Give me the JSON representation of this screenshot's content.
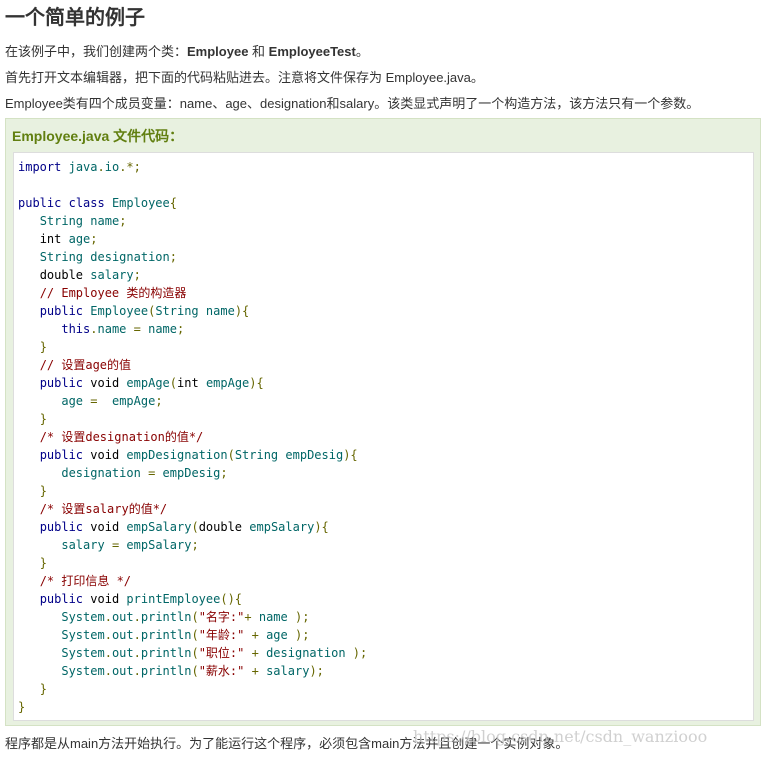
{
  "heading": "一个简单的例子",
  "paragraphs": {
    "p1_prefix": "在该例子中，我们创建两个类：",
    "p1_class1": "Employee",
    "p1_mid": " 和 ",
    "p1_class2": "EmployeeTest",
    "p1_suffix": "。",
    "p2": "首先打开文本编辑器，把下面的代码粘贴进去。注意将文件保存为 Employee.java。",
    "p3": "Employee类有四个成员变量：name、age、designation和salary。该类显式声明了一个构造方法，该方法只有一个参数。",
    "bottom": "程序都是从main方法开始执行。为了能运行这个程序，必须包含main方法并且创建一个实例对象。"
  },
  "example": {
    "title": "Employee.java 文件代码："
  },
  "code_lines": [
    [
      [
        "kw2",
        "import"
      ],
      [
        "plain",
        " "
      ],
      [
        "var",
        "java"
      ],
      [
        "pun",
        "."
      ],
      [
        "var",
        "io"
      ],
      [
        "pun",
        ".*;"
      ]
    ],
    [],
    [
      [
        "kw2",
        "public"
      ],
      [
        "plain",
        " "
      ],
      [
        "kw2",
        "class"
      ],
      [
        "plain",
        " "
      ],
      [
        "var",
        "Employee"
      ],
      [
        "pun",
        "{"
      ]
    ],
    [
      [
        "plain",
        "   "
      ],
      [
        "var",
        "String"
      ],
      [
        "plain",
        " "
      ],
      [
        "var",
        "name"
      ],
      [
        "pun",
        ";"
      ]
    ],
    [
      [
        "plain",
        "   "
      ],
      [
        "plain",
        "int"
      ],
      [
        "plain",
        " "
      ],
      [
        "var",
        "age"
      ],
      [
        "pun",
        ";"
      ]
    ],
    [
      [
        "plain",
        "   "
      ],
      [
        "var",
        "String"
      ],
      [
        "plain",
        " "
      ],
      [
        "var",
        "designation"
      ],
      [
        "pun",
        ";"
      ]
    ],
    [
      [
        "plain",
        "   "
      ],
      [
        "plain",
        "double"
      ],
      [
        "plain",
        " "
      ],
      [
        "var",
        "salary"
      ],
      [
        "pun",
        ";"
      ]
    ],
    [
      [
        "plain",
        "   "
      ],
      [
        "cm",
        "// Employee 类的构造器"
      ]
    ],
    [
      [
        "plain",
        "   "
      ],
      [
        "kw2",
        "public"
      ],
      [
        "plain",
        " "
      ],
      [
        "var",
        "Employee"
      ],
      [
        "pun",
        "("
      ],
      [
        "var",
        "String"
      ],
      [
        "plain",
        " "
      ],
      [
        "var",
        "name"
      ],
      [
        "pun",
        "){"
      ]
    ],
    [
      [
        "plain",
        "      "
      ],
      [
        "kw",
        "this"
      ],
      [
        "pun",
        "."
      ],
      [
        "var",
        "name"
      ],
      [
        "plain",
        " "
      ],
      [
        "pun",
        "="
      ],
      [
        "plain",
        " "
      ],
      [
        "var",
        "name"
      ],
      [
        "pun",
        ";"
      ]
    ],
    [
      [
        "plain",
        "   "
      ],
      [
        "pun",
        "}"
      ]
    ],
    [
      [
        "plain",
        "   "
      ],
      [
        "cm",
        "// 设置age的值"
      ]
    ],
    [
      [
        "plain",
        "   "
      ],
      [
        "kw2",
        "public"
      ],
      [
        "plain",
        " "
      ],
      [
        "plain",
        "void"
      ],
      [
        "plain",
        " "
      ],
      [
        "var",
        "empAge"
      ],
      [
        "pun",
        "("
      ],
      [
        "plain",
        "int"
      ],
      [
        "plain",
        " "
      ],
      [
        "var",
        "empAge"
      ],
      [
        "pun",
        "){"
      ]
    ],
    [
      [
        "plain",
        "      "
      ],
      [
        "var",
        "age"
      ],
      [
        "plain",
        " "
      ],
      [
        "pun",
        "="
      ],
      [
        "plain",
        "  "
      ],
      [
        "var",
        "empAge"
      ],
      [
        "pun",
        ";"
      ]
    ],
    [
      [
        "plain",
        "   "
      ],
      [
        "pun",
        "}"
      ]
    ],
    [
      [
        "plain",
        "   "
      ],
      [
        "cm",
        "/* 设置designation的值*/"
      ]
    ],
    [
      [
        "plain",
        "   "
      ],
      [
        "kw2",
        "public"
      ],
      [
        "plain",
        " "
      ],
      [
        "plain",
        "void"
      ],
      [
        "plain",
        " "
      ],
      [
        "var",
        "empDesignation"
      ],
      [
        "pun",
        "("
      ],
      [
        "var",
        "String"
      ],
      [
        "plain",
        " "
      ],
      [
        "var",
        "empDesig"
      ],
      [
        "pun",
        "){"
      ]
    ],
    [
      [
        "plain",
        "      "
      ],
      [
        "var",
        "designation"
      ],
      [
        "plain",
        " "
      ],
      [
        "pun",
        "="
      ],
      [
        "plain",
        " "
      ],
      [
        "var",
        "empDesig"
      ],
      [
        "pun",
        ";"
      ]
    ],
    [
      [
        "plain",
        "   "
      ],
      [
        "pun",
        "}"
      ]
    ],
    [
      [
        "plain",
        "   "
      ],
      [
        "cm",
        "/* 设置salary的值*/"
      ]
    ],
    [
      [
        "plain",
        "   "
      ],
      [
        "kw2",
        "public"
      ],
      [
        "plain",
        " "
      ],
      [
        "plain",
        "void"
      ],
      [
        "plain",
        " "
      ],
      [
        "var",
        "empSalary"
      ],
      [
        "pun",
        "("
      ],
      [
        "plain",
        "double"
      ],
      [
        "plain",
        " "
      ],
      [
        "var",
        "empSalary"
      ],
      [
        "pun",
        "){"
      ]
    ],
    [
      [
        "plain",
        "      "
      ],
      [
        "var",
        "salary"
      ],
      [
        "plain",
        " "
      ],
      [
        "pun",
        "="
      ],
      [
        "plain",
        " "
      ],
      [
        "var",
        "empSalary"
      ],
      [
        "pun",
        ";"
      ]
    ],
    [
      [
        "plain",
        "   "
      ],
      [
        "pun",
        "}"
      ]
    ],
    [
      [
        "plain",
        "   "
      ],
      [
        "cm",
        "/* 打印信息 */"
      ]
    ],
    [
      [
        "plain",
        "   "
      ],
      [
        "kw2",
        "public"
      ],
      [
        "plain",
        " "
      ],
      [
        "plain",
        "void"
      ],
      [
        "plain",
        " "
      ],
      [
        "var",
        "printEmployee"
      ],
      [
        "pun",
        "(){"
      ]
    ],
    [
      [
        "plain",
        "      "
      ],
      [
        "var",
        "System"
      ],
      [
        "pun",
        "."
      ],
      [
        "var",
        "out"
      ],
      [
        "pun",
        "."
      ],
      [
        "var",
        "println"
      ],
      [
        "pun",
        "("
      ],
      [
        "str",
        "\"名字:\""
      ],
      [
        "pun",
        "+"
      ],
      [
        "plain",
        " "
      ],
      [
        "var",
        "name"
      ],
      [
        "plain",
        " "
      ],
      [
        "pun",
        ");"
      ]
    ],
    [
      [
        "plain",
        "      "
      ],
      [
        "var",
        "System"
      ],
      [
        "pun",
        "."
      ],
      [
        "var",
        "out"
      ],
      [
        "pun",
        "."
      ],
      [
        "var",
        "println"
      ],
      [
        "pun",
        "("
      ],
      [
        "str",
        "\"年龄:\""
      ],
      [
        "plain",
        " "
      ],
      [
        "pun",
        "+"
      ],
      [
        "plain",
        " "
      ],
      [
        "var",
        "age"
      ],
      [
        "plain",
        " "
      ],
      [
        "pun",
        ");"
      ]
    ],
    [
      [
        "plain",
        "      "
      ],
      [
        "var",
        "System"
      ],
      [
        "pun",
        "."
      ],
      [
        "var",
        "out"
      ],
      [
        "pun",
        "."
      ],
      [
        "var",
        "println"
      ],
      [
        "pun",
        "("
      ],
      [
        "str",
        "\"职位:\""
      ],
      [
        "plain",
        " "
      ],
      [
        "pun",
        "+"
      ],
      [
        "plain",
        " "
      ],
      [
        "var",
        "designation"
      ],
      [
        "plain",
        " "
      ],
      [
        "pun",
        ");"
      ]
    ],
    [
      [
        "plain",
        "      "
      ],
      [
        "var",
        "System"
      ],
      [
        "pun",
        "."
      ],
      [
        "var",
        "out"
      ],
      [
        "pun",
        "."
      ],
      [
        "var",
        "println"
      ],
      [
        "pun",
        "("
      ],
      [
        "str",
        "\"薪水:\""
      ],
      [
        "plain",
        " "
      ],
      [
        "pun",
        "+"
      ],
      [
        "plain",
        " "
      ],
      [
        "var",
        "salary"
      ],
      [
        "pun",
        ");"
      ]
    ],
    [
      [
        "plain",
        "   "
      ],
      [
        "pun",
        "}"
      ]
    ],
    [
      [
        "pun",
        "}"
      ]
    ]
  ],
  "watermark": "https://blog.csdn.net/csdn_wanziooo",
  "colors": {
    "example_bg": "#e8f1e0",
    "example_title": "#617f10",
    "keyword": "#000088",
    "identifier": "#006666",
    "comment": "#880000",
    "string": "#880000",
    "punctuation": "#666600"
  }
}
